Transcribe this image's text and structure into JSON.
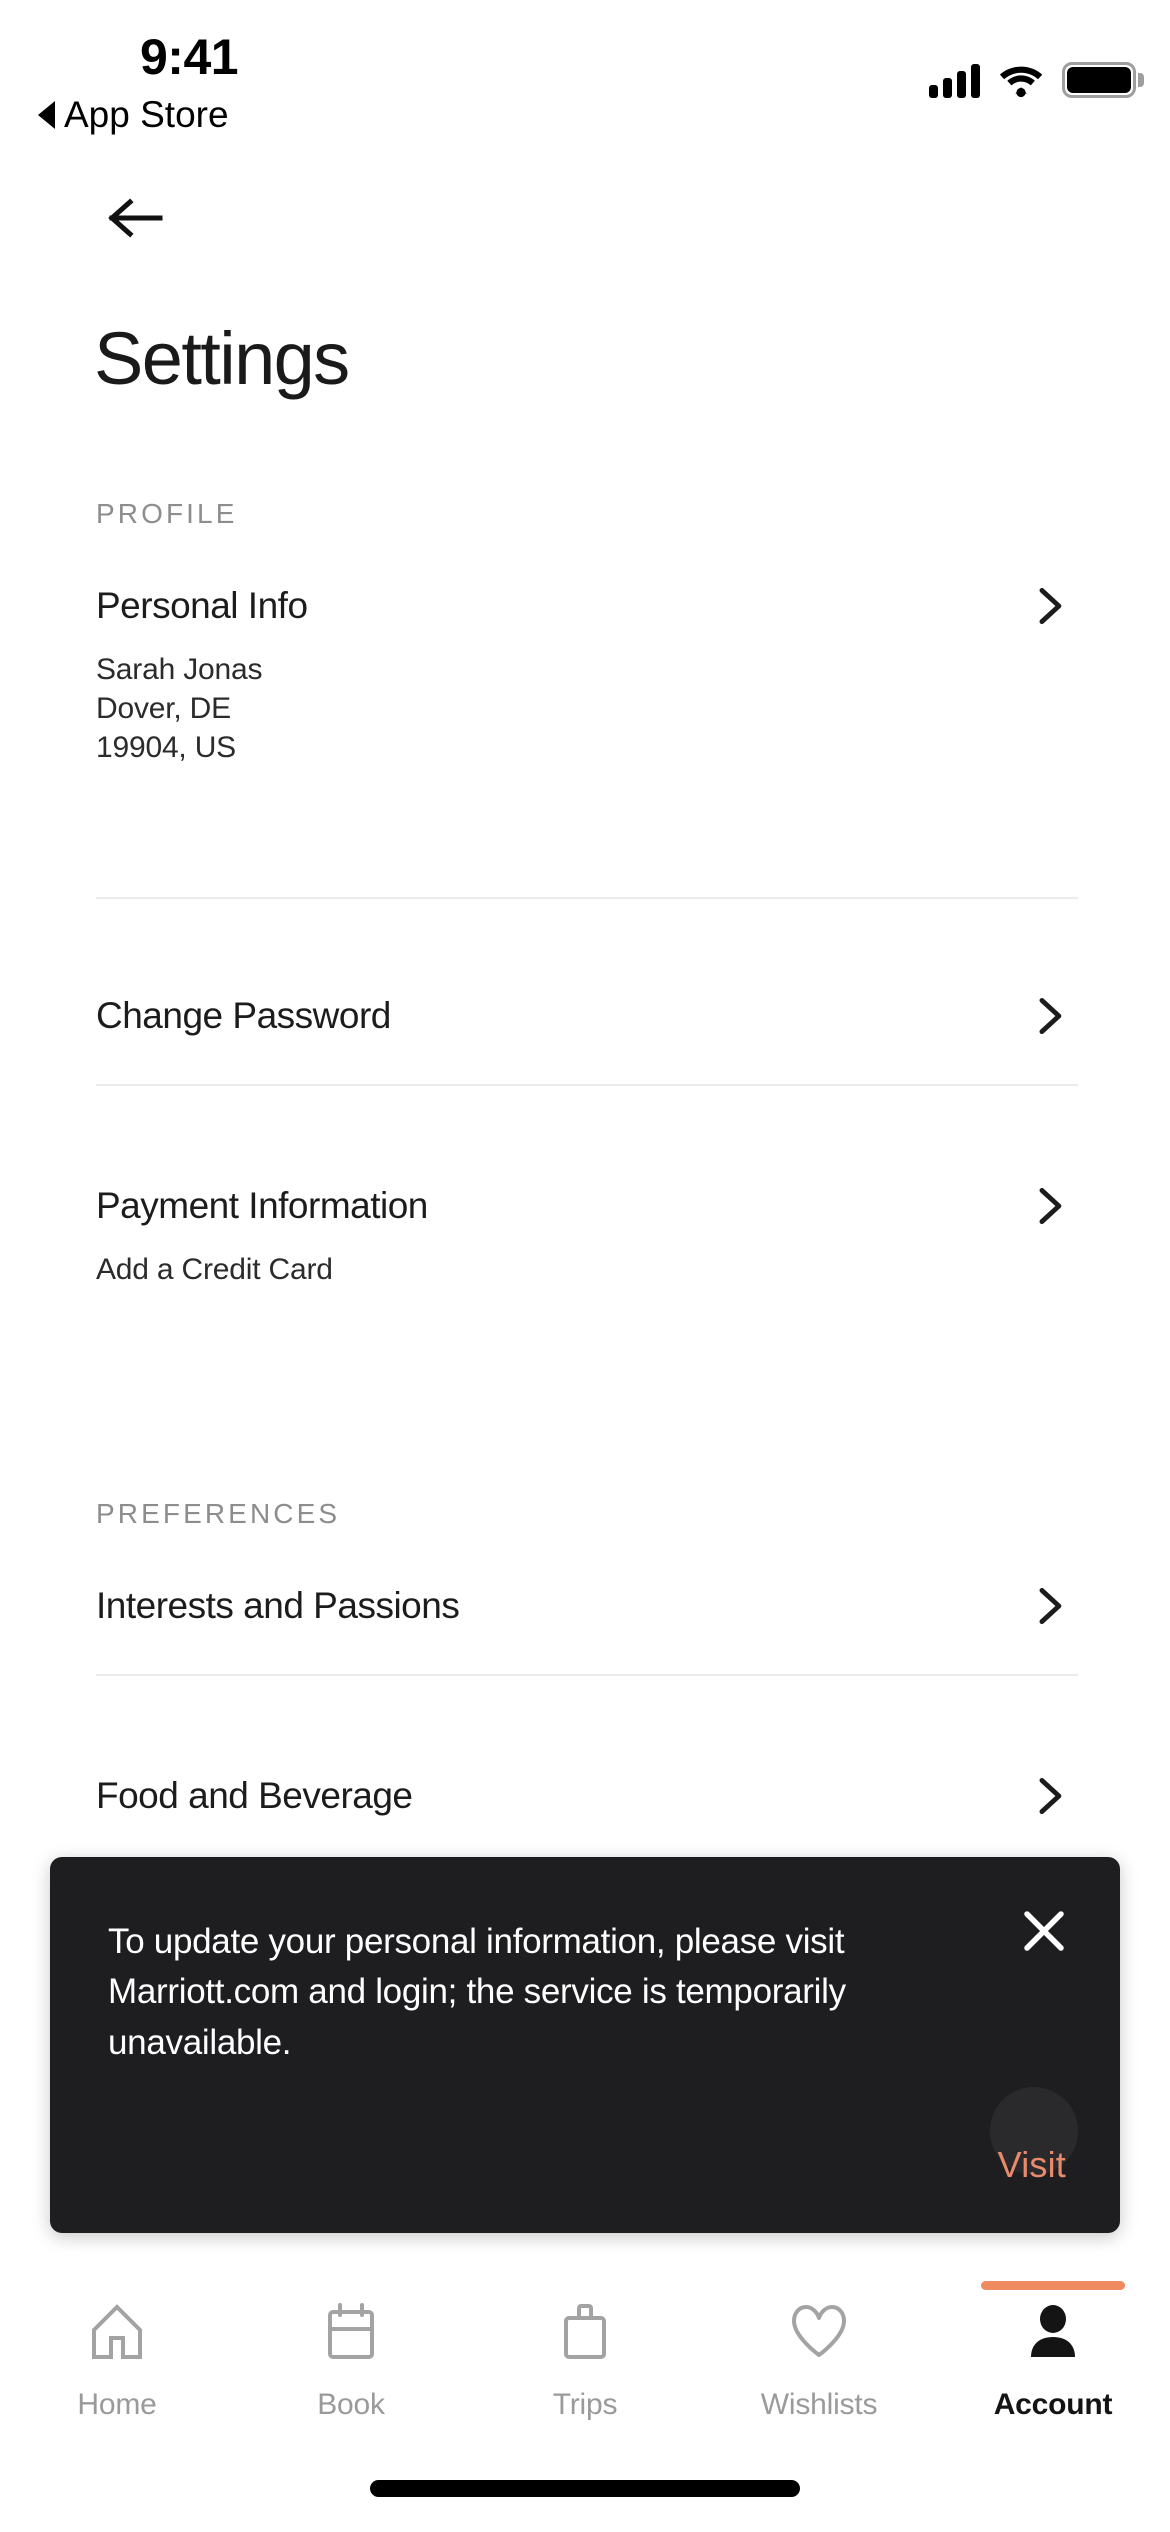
{
  "status_bar": {
    "time": "9:41",
    "back_app_label": "App Store",
    "signal_icon": "cellular-signal-icon",
    "wifi_icon": "wifi-icon",
    "battery_icon": "battery-full-icon"
  },
  "nav": {
    "back_icon": "arrow-left-icon"
  },
  "header": {
    "title": "Settings"
  },
  "sections": [
    {
      "label": "PROFILE",
      "rows": [
        {
          "title": "Personal Info",
          "sublines": [
            "Sarah Jonas",
            "Dover, DE",
            "19904, US"
          ],
          "chevron": "chevron-right-icon"
        },
        {
          "title": "Change Password",
          "sublines": [],
          "chevron": "chevron-right-icon"
        },
        {
          "title": "Payment Information",
          "sublines": [
            "Add a Credit Card"
          ],
          "chevron": "chevron-right-icon"
        }
      ]
    },
    {
      "label": "PREFERENCES",
      "rows": [
        {
          "title": "Interests and Passions",
          "sublines": [],
          "chevron": "chevron-right-icon"
        },
        {
          "title": "Food and Beverage",
          "sublines": [],
          "chevron": "chevron-right-icon"
        }
      ]
    }
  ],
  "toast": {
    "message": "To update your personal information, please visit Marriott.com and login; the service is temporarily unavailable.",
    "action_label": "Visit",
    "action_color": "#EA8A6D",
    "close_icon": "close-icon",
    "background_color": "#1E1E20"
  },
  "tabbar": {
    "active_indicator_color": "#F08A5F",
    "items": [
      {
        "label": "Home",
        "icon": "home-icon",
        "active": false
      },
      {
        "label": "Book",
        "icon": "calendar-icon",
        "active": false
      },
      {
        "label": "Trips",
        "icon": "briefcase-icon",
        "active": false
      },
      {
        "label": "Wishlists",
        "icon": "heart-icon",
        "active": false
      },
      {
        "label": "Account",
        "icon": "person-icon",
        "active": true
      }
    ]
  }
}
